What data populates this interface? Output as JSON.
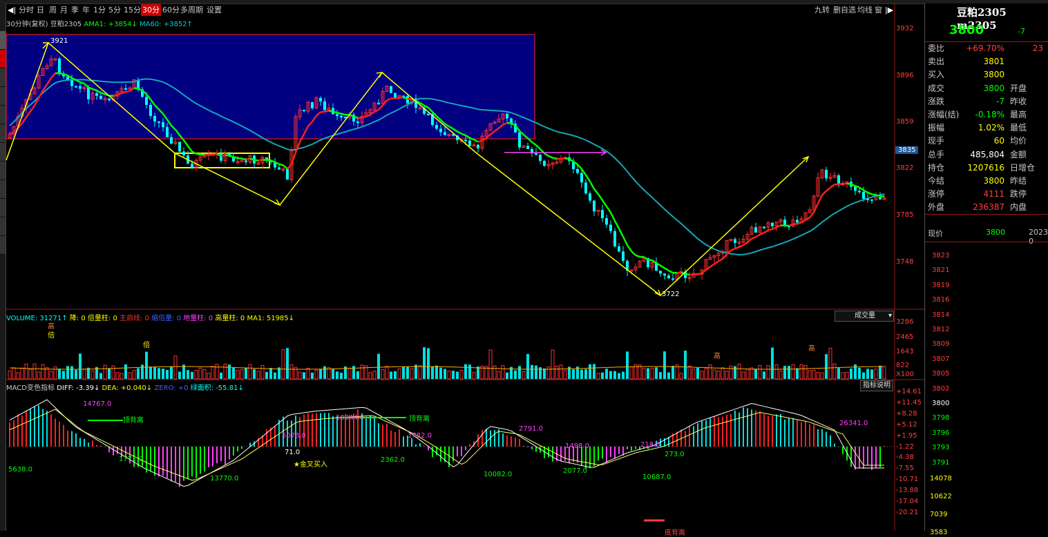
{
  "toolbar": {
    "items": [
      "分时",
      "日",
      "周",
      "月",
      "季",
      "年",
      "1分",
      "5分",
      "15分",
      "30分",
      "60分",
      "多周期",
      "设置"
    ],
    "active": "30分",
    "right_items": [
      "九转",
      "删自选",
      "均线",
      "窗"
    ]
  },
  "main_chart": {
    "title": "30分钟(复权)",
    "symbol": "豆粕2305",
    "ama1": "AMA1: +3854↓",
    "ma60": "MA60: +3852↑",
    "y_ticks": [
      "3932",
      "3896",
      "3859",
      "3835",
      "3822",
      "3785",
      "3748"
    ],
    "highlight_tick": "3835",
    "high_label": "3921",
    "low_label": "3722"
  },
  "volume_panel": {
    "title": "VOLUME: 31271↑",
    "fields": [
      "降: 0",
      "倍量柱: 0",
      "主启线: 0",
      "缩倍量: 0",
      "地量柱: 0",
      "高量柱: 0",
      "MA1: 51985↓"
    ],
    "dropdown": "成交量",
    "y_ticks": [
      "3286",
      "2465",
      "1643",
      "822",
      "X100"
    ],
    "bar_mark": "倍",
    "high_mark": "高"
  },
  "macd_panel": {
    "title": "MACD变色指标",
    "diff": "DIFF: -3.39↓",
    "dea": "DEA: +0.040↓",
    "zero": "ZERO: +0",
    "green_area": "绿面积: -55.81↓",
    "help_button": "指标说明",
    "y_ticks": [
      "+14.61",
      "+11.45",
      "+8.28",
      "+5.12",
      "+1.95",
      "-1.22",
      "-4.38",
      "-7.55",
      "-10.71",
      "-13.88",
      "-17.04",
      "-20.21"
    ],
    "annotations": [
      "14767.0",
      "顶背离",
      "1771.0",
      "5638.0",
      "13770.0",
      "5078.0",
      "71.0",
      "金叉买入",
      "18344.0",
      "顶背离",
      "1782.0",
      "2362.0",
      "2791.0",
      "10082.0",
      "1498.0",
      "2077.0",
      "218.0",
      "273.0",
      "10687.0",
      "26341.0",
      "底背离"
    ]
  },
  "quote_panel": {
    "title": "豆粕2305 m2305",
    "last_price": "3800",
    "change": "-7",
    "rows": [
      {
        "label": "委比",
        "value": "+69.70%",
        "extra": "23",
        "color": "#ff4040"
      },
      {
        "label": "卖出",
        "value": "3801",
        "extra": "",
        "color": "#ffff00"
      },
      {
        "label": "买入",
        "value": "3800",
        "extra": "",
        "color": "#ffff00"
      },
      {
        "label": "成交",
        "value": "3800",
        "extra": "开盘",
        "color": "#00ff00"
      },
      {
        "label": "涨跌",
        "value": "-7",
        "extra": "昨收",
        "color": "#00ff00"
      },
      {
        "label": "涨幅(结)",
        "value": "-0.18%",
        "extra": "最高",
        "color": "#00ff00"
      },
      {
        "label": "振幅",
        "value": "1.02%",
        "extra": "最低",
        "color": "#ffff00"
      },
      {
        "label": "现手",
        "value": "60",
        "extra": "均价",
        "color": "#ffff00"
      },
      {
        "label": "总手",
        "value": "485,804",
        "extra": "金额",
        "color": "#ffffff"
      },
      {
        "label": "持仓",
        "value": "1207616",
        "extra": "日增仓",
        "color": "#ffff00"
      },
      {
        "label": "今结",
        "value": "3800",
        "extra": "昨结",
        "color": "#ffff00"
      },
      {
        "label": "涨停",
        "value": "4111",
        "extra": "跌停",
        "color": "#ff4040"
      },
      {
        "label": "外盘",
        "value": "236387",
        "extra": "内盘",
        "color": "#ff4040"
      }
    ],
    "intraday_label": "现价",
    "intraday_value": "3800",
    "intraday_date": "2023-0",
    "intraday_ticks": [
      "3823",
      "3821",
      "3819",
      "3816",
      "3814",
      "3812",
      "3809",
      "3807",
      "3805",
      "3802",
      "3800",
      "3798",
      "3796",
      "3793",
      "3791"
    ],
    "vol_ticks": [
      "14078",
      "10622",
      "7039",
      "3583"
    ]
  },
  "colors": {
    "up": "#ff3030",
    "down": "#00ffff",
    "ama": "#00ff00",
    "ma60": "#00aaaa",
    "box": "#000080",
    "yellow": "#ffff00"
  }
}
